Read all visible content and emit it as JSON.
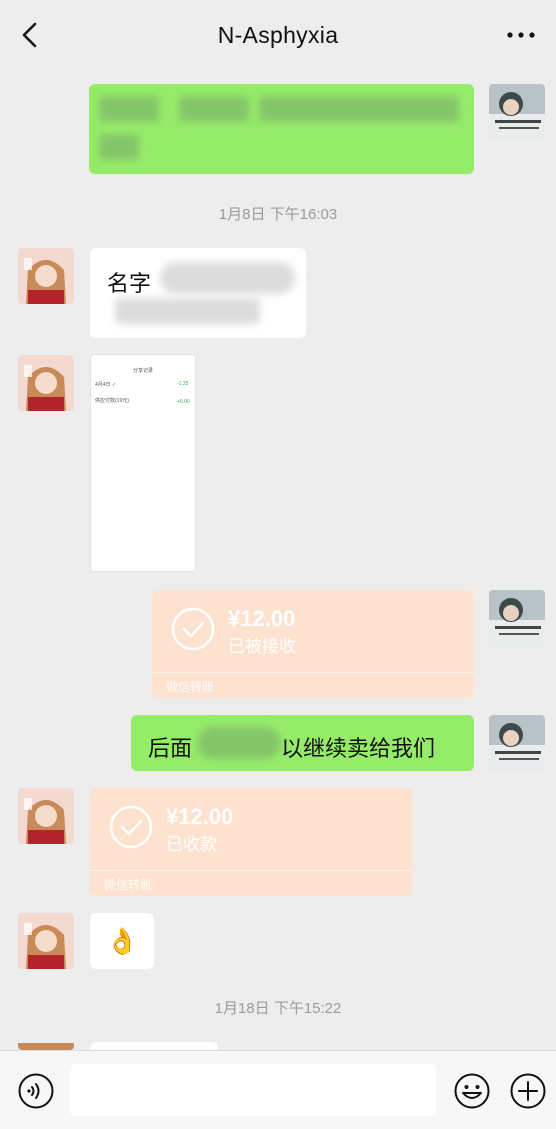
{
  "header": {
    "title": "N-Asphyxia"
  },
  "timestamps": {
    "first": "1月8日 下午16:03",
    "second": "1月18日 下午15:22"
  },
  "messages": {
    "name_prefix": "名字",
    "later_prefix": "后面",
    "later_suffix": "以继续卖给我们"
  },
  "transfers": {
    "sent": {
      "amount": "¥12.00",
      "status": "已被接收",
      "footer": "微信转账"
    },
    "received": {
      "amount": "¥12.00",
      "status": "已收款",
      "footer": "微信转账"
    }
  },
  "screenshot_preview": {
    "title": "分享记录",
    "row1_label": "4月4日 ✓",
    "row1_value": "-1.25",
    "row2_label": "供应付款(19元)",
    "row2_value": "+0.00"
  },
  "emoji": "👌",
  "input": {
    "placeholder": ""
  },
  "colors": {
    "background": "#ededed",
    "sent_bubble": "#95ec69",
    "received_bubble": "#ffffff",
    "transfer": "#fde3cf"
  }
}
